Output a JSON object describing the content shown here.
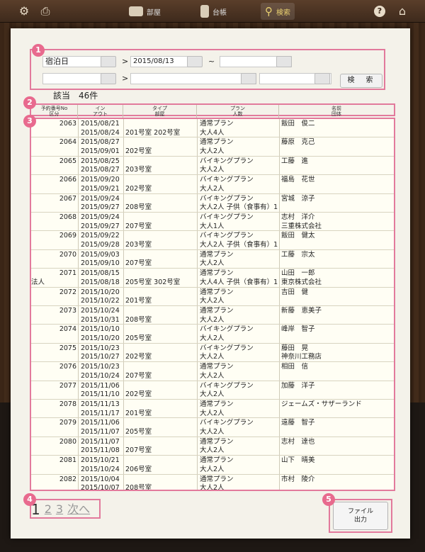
{
  "toolbar": {
    "rooms_label": "部屋",
    "ledger_label": "台帳",
    "search_label": "検索"
  },
  "badges": [
    "1",
    "2",
    "3",
    "4",
    "5"
  ],
  "search": {
    "field1_value": "宿泊日",
    "date_from": "2015/08/13",
    "gt": ">",
    "tilde": "~",
    "button_label": "検　索"
  },
  "result_count": "該当　46件",
  "table_header": [
    {
      "line1": "予約番号No",
      "line2": "区分"
    },
    {
      "line1": "イン",
      "line2": "アウト"
    },
    {
      "line1": "タイプ",
      "line2": "部屋"
    },
    {
      "line1": "プラン",
      "line2": "人数"
    },
    {
      "line1": "名前",
      "line2": "団体"
    }
  ],
  "rows": [
    {
      "no": "2063",
      "cat": "",
      "in": "2015/08/21",
      "out": "2015/08/24",
      "room": "201号室 202号室",
      "plan": "通常プラン",
      "people": "大人4人",
      "name": "飯田　俊二",
      "group": ""
    },
    {
      "no": "2064",
      "cat": "",
      "in": "2015/08/27",
      "out": "2015/09/01",
      "room": "202号室",
      "plan": "通常プラン",
      "people": "大人2人",
      "name": "藤原　克己",
      "group": ""
    },
    {
      "no": "2065",
      "cat": "",
      "in": "2015/08/25",
      "out": "2015/08/27",
      "room": "203号室",
      "plan": "バイキングプラン",
      "people": "大人2人",
      "name": "工藤　進",
      "group": ""
    },
    {
      "no": "2066",
      "cat": "",
      "in": "2015/09/20",
      "out": "2015/09/21",
      "room": "202号室",
      "plan": "バイキングプラン",
      "people": "大人2人",
      "name": "福島　花世",
      "group": ""
    },
    {
      "no": "2067",
      "cat": "",
      "in": "2015/09/24",
      "out": "2015/09/27",
      "room": "208号室",
      "plan": "バイキングプラン",
      "people": "大人2人 子供（食事有）1",
      "name": "宮城　涼子",
      "group": ""
    },
    {
      "no": "2068",
      "cat": "",
      "in": "2015/09/24",
      "out": "2015/09/27",
      "room": "207号室",
      "plan": "バイキングプラン",
      "people": "大人1人",
      "name": "志村　洋介",
      "group": "三重株式会社"
    },
    {
      "no": "2069",
      "cat": "",
      "in": "2015/09/22",
      "out": "2015/09/28",
      "room": "203号室",
      "plan": "バイキングプラン",
      "people": "大人2人 子供（食事有）1",
      "name": "飯田　健太",
      "group": ""
    },
    {
      "no": "2070",
      "cat": "",
      "in": "2015/09/03",
      "out": "2015/09/10",
      "room": "207号室",
      "plan": "通常プラン",
      "people": "大人2人",
      "name": "工藤　宗太",
      "group": ""
    },
    {
      "no": "2071",
      "cat": "法人",
      "in": "2015/08/15",
      "out": "2015/08/18",
      "room": "205号室 302号室",
      "plan": "通常プラン",
      "people": "大人4人 子供（食事有）1",
      "name": "山田　一郎",
      "group": "東京株式会社"
    },
    {
      "no": "2072",
      "cat": "",
      "in": "2015/10/20",
      "out": "2015/10/22",
      "room": "201号室",
      "plan": "通常プラン",
      "people": "大人2人",
      "name": "吉田　健",
      "group": ""
    },
    {
      "no": "2073",
      "cat": "",
      "in": "2015/10/24",
      "out": "2015/10/31",
      "room": "208号室",
      "plan": "通常プラン",
      "people": "大人2人",
      "name": "新藤　恵美子",
      "group": ""
    },
    {
      "no": "2074",
      "cat": "",
      "in": "2015/10/10",
      "out": "2015/10/20",
      "room": "205号室",
      "plan": "バイキングプラン",
      "people": "大人2人",
      "name": "峰岸　智子",
      "group": ""
    },
    {
      "no": "2075",
      "cat": "",
      "in": "2015/10/23",
      "out": "2015/10/27",
      "room": "202号室",
      "plan": "バイキングプラン",
      "people": "大人2人",
      "name": "藤田　晃",
      "group": "神奈川工務店"
    },
    {
      "no": "2076",
      "cat": "",
      "in": "2015/10/23",
      "out": "2015/10/24",
      "room": "207号室",
      "plan": "通常プラン",
      "people": "大人2人",
      "name": "相田　信",
      "group": ""
    },
    {
      "no": "2077",
      "cat": "",
      "in": "2015/11/06",
      "out": "2015/11/10",
      "room": "202号室",
      "plan": "バイキングプラン",
      "people": "大人2人",
      "name": "加藤　洋子",
      "group": ""
    },
    {
      "no": "2078",
      "cat": "",
      "in": "2015/11/13",
      "out": "2015/11/17",
      "room": "201号室",
      "plan": "通常プラン",
      "people": "大人2人",
      "name": "ジェームズ・サザーランド",
      "group": ""
    },
    {
      "no": "2079",
      "cat": "",
      "in": "2015/11/06",
      "out": "2015/11/07",
      "room": "205号室",
      "plan": "バイキングプラン",
      "people": "大人2人",
      "name": "遠藤　智子",
      "group": ""
    },
    {
      "no": "2080",
      "cat": "",
      "in": "2015/11/07",
      "out": "2015/11/08",
      "room": "207号室",
      "plan": "通常プラン",
      "people": "大人2人",
      "name": "志村　達也",
      "group": ""
    },
    {
      "no": "2081",
      "cat": "",
      "in": "2015/10/21",
      "out": "2015/10/24",
      "room": "206号室",
      "plan": "通常プラン",
      "people": "大人2人",
      "name": "山下　晴美",
      "group": ""
    },
    {
      "no": "2082",
      "cat": "",
      "in": "2015/10/04",
      "out": "2015/10/07",
      "room": "208号室",
      "plan": "通常プラン",
      "people": "大人2人",
      "name": "市村　陵介",
      "group": ""
    }
  ],
  "pagination": {
    "current": "1",
    "p2": "2",
    "p3": "3",
    "next": "次へ"
  },
  "export": {
    "line1": "ファイル",
    "line2": "出力"
  }
}
